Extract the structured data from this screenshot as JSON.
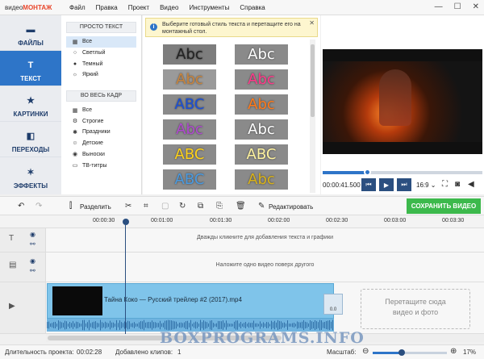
{
  "app": {
    "logo_prefix": "видео",
    "logo_brand": "МОНТАЖ"
  },
  "menu": [
    "Файл",
    "Правка",
    "Проект",
    "Видео",
    "Инструменты",
    "Справка"
  ],
  "window_controls": {
    "minimize": "—",
    "maximize": "☐",
    "close": "✕"
  },
  "sidebar": [
    {
      "label": "ФАЙЛЫ",
      "icon": "folder-icon",
      "glyph": "▬",
      "active": false
    },
    {
      "label": "ТЕКСТ",
      "icon": "text-icon",
      "glyph": "T",
      "active": true
    },
    {
      "label": "КАРТИНКИ",
      "icon": "star-icon",
      "glyph": "★",
      "active": false
    },
    {
      "label": "ПЕРЕХОДЫ",
      "icon": "transitions-icon",
      "glyph": "◧",
      "active": false
    },
    {
      "label": "ЭФФЕКТЫ",
      "icon": "magic-wand-icon",
      "glyph": "✶",
      "active": false
    }
  ],
  "categories": {
    "simple_header": "ПРОСТО ТЕКСТ",
    "simple_items": [
      {
        "label": "Все",
        "glyph": "▦",
        "selected": true
      },
      {
        "label": "Светлый",
        "glyph": "○",
        "selected": false
      },
      {
        "label": "Темный",
        "glyph": "●",
        "selected": false
      },
      {
        "label": "Яркий",
        "glyph": "☼",
        "selected": false
      }
    ],
    "frame_header": "ВО ВЕСЬ КАДР",
    "frame_items": [
      {
        "label": "Все",
        "glyph": "▦"
      },
      {
        "label": "Строгие",
        "glyph": "⚙"
      },
      {
        "label": "Праздники",
        "glyph": "✱"
      },
      {
        "label": "Детские",
        "glyph": "☺"
      },
      {
        "label": "Выноски",
        "glyph": "◉"
      },
      {
        "label": "ТВ-титры",
        "glyph": "▭"
      }
    ]
  },
  "hint": {
    "text": "Выберите готовый стиль текста и перетащите его на монтажный стол.",
    "close": "✕"
  },
  "style_tiles": [
    {
      "text": "Abc",
      "color": "#222222",
      "bg": "#7d7d7d"
    },
    {
      "text": "Abc",
      "color": "#ffffff",
      "bg": "#8a8a8a"
    },
    {
      "text": "Abc",
      "color": "#c8843c",
      "bg": "#9a9a9a"
    },
    {
      "text": "Abc",
      "color": "#ff3a8a",
      "bg": "#8a8a8a"
    },
    {
      "text": "ABC",
      "color": "#1a4fd6",
      "bg": "#8a8a8a"
    },
    {
      "text": "Abc",
      "color": "#ff7a1a",
      "bg": "#8a8a8a"
    },
    {
      "text": "Abc",
      "color": "#b04ad0",
      "bg": "#8a8a8a"
    },
    {
      "text": "Abc",
      "color": "#ffffff",
      "bg": "#8a8a8a"
    },
    {
      "text": "ABC",
      "color": "#ffd21a",
      "bg": "#8a8a8a"
    },
    {
      "text": "ABC",
      "color": "#fff3a0",
      "bg": "#8a8a8a"
    },
    {
      "text": "ABC",
      "color": "#4a9ae0",
      "bg": "#8a8a8a"
    },
    {
      "text": "Abc",
      "color": "#d9b21a",
      "bg": "#8a8a8a"
    }
  ],
  "player": {
    "time": "00:00:41.500",
    "ratio": "16:9 ⌄",
    "progress": 0.28
  },
  "toolbar": {
    "split_label": "Разделить",
    "edit_label": "Редактировать",
    "save_label": "СОХРАНИТЬ ВИДЕО"
  },
  "ruler": [
    "00:00:30",
    "00:01:00",
    "00:01:30",
    "00:02:00",
    "00:02:30",
    "00:03:00",
    "00:03:30"
  ],
  "tracks": {
    "text_hint": "Дважды кликните для добавления текста и графики",
    "overlay_hint": "Наложите одно видео поверх другого",
    "clip_label": "Тайна Коко — Русский трейлер #2 (2017).mp4",
    "transition_label": "0.0",
    "drop_text_1": "Перетащите сюда",
    "drop_text_2": "видео и фото"
  },
  "status": {
    "duration_label": "Длительность проекта:",
    "duration_value": "00:02:28",
    "clips_label": "Добавлено клипов:",
    "clips_value": "1",
    "zoom_label": "Масштаб:",
    "zoom_value": "17%",
    "zoom_level": 0.17
  },
  "watermark": "BOXPROGRAMS.INFO"
}
